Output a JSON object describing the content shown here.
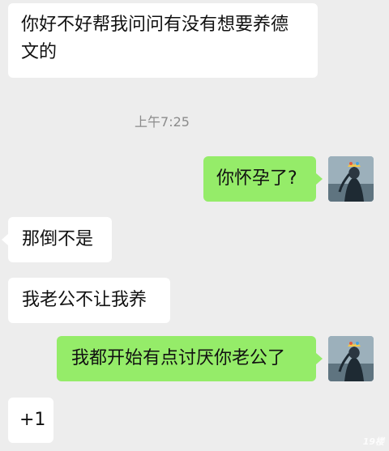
{
  "chat": {
    "messages": [
      {
        "text": "你好不好帮我问问有没有想要养德文的",
        "side": "incoming"
      },
      {
        "text": "你怀孕了?",
        "side": "outgoing"
      },
      {
        "text": "那倒不是",
        "side": "incoming"
      },
      {
        "text": "我老公不让我养",
        "side": "incoming"
      },
      {
        "text": "我都开始有点讨厌你老公了",
        "side": "outgoing"
      },
      {
        "text": "+1",
        "side": "incoming"
      }
    ],
    "timestamp": "上午7:25"
  },
  "colors": {
    "background": "#ededed",
    "incoming_bubble": "#ffffff",
    "outgoing_bubble": "#95ec69"
  },
  "watermark": "19楼"
}
